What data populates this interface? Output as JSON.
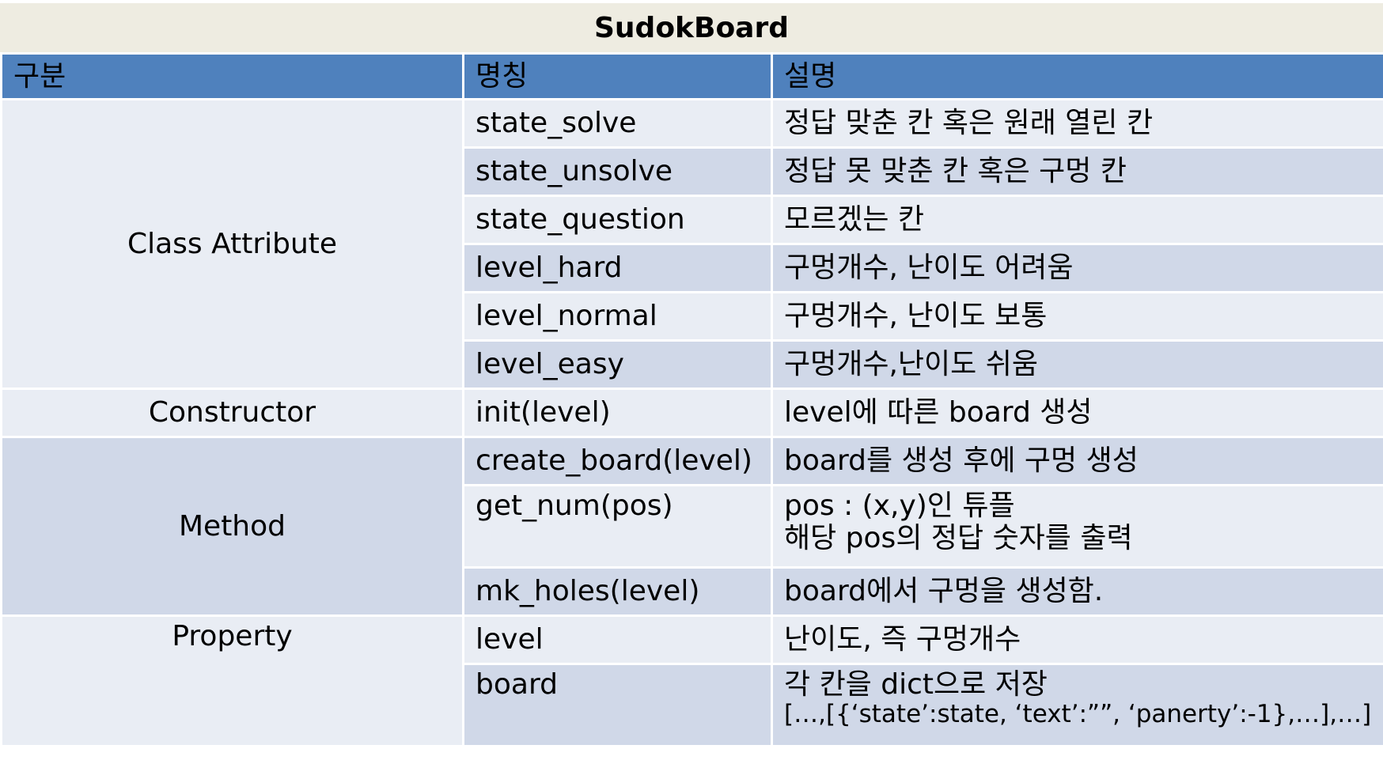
{
  "title": "SudokBoard",
  "header": {
    "col1": "구분",
    "col2": "명칭",
    "col3": "설명"
  },
  "groups": {
    "class_attribute": "Class Attribute",
    "constructor": "Constructor",
    "method": "Method",
    "property": "Property"
  },
  "rows": [
    {
      "name": "state_solve",
      "desc": "정답 맞춘 칸 혹은 원래 열린 칸"
    },
    {
      "name": "state_unsolve",
      "desc": "정답 못 맞춘 칸 혹은 구멍 칸"
    },
    {
      "name": "state_question",
      "desc": "모르겠는 칸"
    },
    {
      "name": "level_hard",
      "desc": "구멍개수, 난이도 어려움"
    },
    {
      "name": "level_normal",
      "desc": "구멍개수, 난이도 보통"
    },
    {
      "name": "level_easy",
      "desc": "구멍개수,난이도 쉬움"
    },
    {
      "name": "init(level)",
      "desc": "level에 따른 board 생성"
    },
    {
      "name": "create_board(level)",
      "desc": "board를 생성 후에 구멍 생성"
    },
    {
      "name": "get_num(pos)",
      "desc": "pos : (x,y)인 튜플",
      "desc2": "해당 pos의 정답 숫자를 출력"
    },
    {
      "name": "mk_holes(level)",
      "desc": "board에서 구멍을 생성함."
    },
    {
      "name": "level",
      "desc": "난이도, 즉 구멍개수"
    },
    {
      "name": "board",
      "desc": "각 칸을 dict으로 저장",
      "desc2": "[…,[{‘state’:state, ‘text’:””, ‘panerty’:-1},…],…]"
    }
  ],
  "colors": {
    "title_bg": "#eeece1",
    "header_bg": "#4f81bd",
    "row_light": "#e9edf4",
    "row_dark": "#d0d8e8"
  }
}
